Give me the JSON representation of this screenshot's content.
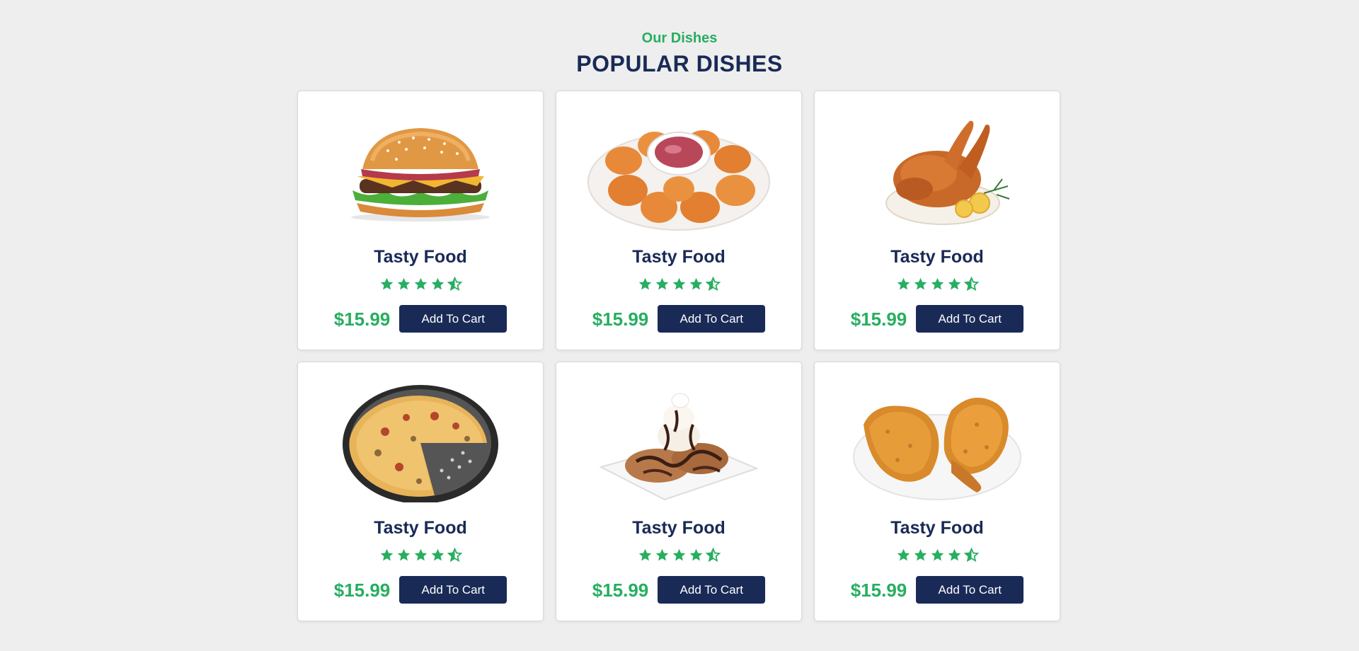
{
  "section": {
    "subtitle": "Our Dishes",
    "title": "POPULAR DISHES"
  },
  "colors": {
    "accent_green": "#27ae60",
    "navy": "#192a56",
    "background": "#eeeeee",
    "card": "#ffffff"
  },
  "dishes": [
    {
      "name": "Tasty Food",
      "price": "$15.99",
      "button_label": "Add To Cart",
      "rating": 4.5,
      "image": "burger"
    },
    {
      "name": "Tasty Food",
      "price": "$15.99",
      "button_label": "Add To Cart",
      "rating": 4.5,
      "image": "chicken-nuggets"
    },
    {
      "name": "Tasty Food",
      "price": "$15.99",
      "button_label": "Add To Cart",
      "rating": 4.5,
      "image": "roast-chicken"
    },
    {
      "name": "Tasty Food",
      "price": "$15.99",
      "button_label": "Add To Cart",
      "rating": 4.5,
      "image": "pizza"
    },
    {
      "name": "Tasty Food",
      "price": "$15.99",
      "button_label": "Add To Cart",
      "rating": 4.5,
      "image": "chocolate-dessert"
    },
    {
      "name": "Tasty Food",
      "price": "$15.99",
      "button_label": "Add To Cart",
      "rating": 4.5,
      "image": "fried-chicken"
    }
  ]
}
